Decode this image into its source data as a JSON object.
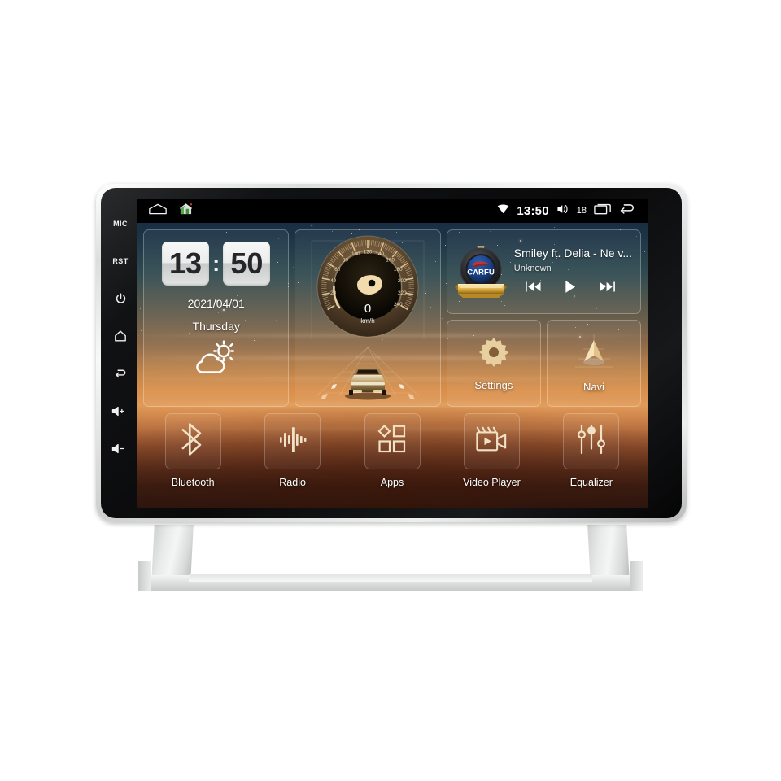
{
  "device": {
    "name": "car-head-unit",
    "bezel_color": "#0a0a0b",
    "chrome_color": "#e8eae9"
  },
  "side_keys": [
    {
      "label": "MIC",
      "icon": "mic-label",
      "name": "side-key-mic"
    },
    {
      "label": "RST",
      "icon": "reset-label",
      "name": "side-key-reset"
    },
    {
      "label": "",
      "icon": "power-icon",
      "name": "side-key-power"
    },
    {
      "label": "",
      "icon": "home-icon",
      "name": "side-key-home"
    },
    {
      "label": "",
      "icon": "back-icon",
      "name": "side-key-back"
    },
    {
      "label": "",
      "icon": "volume-up-icon",
      "name": "side-key-volume-up"
    },
    {
      "label": "",
      "icon": "volume-down-icon",
      "name": "side-key-volume-down"
    }
  ],
  "status_bar": {
    "left_icons": [
      "home-outline-icon",
      "house-color-icon"
    ],
    "wifi_icon": "wifi-icon",
    "time": "13:50",
    "volume_icon": "volume-icon",
    "volume_level": "18",
    "recents_icon": "recents-icon",
    "back_icon": "back-arrow-icon"
  },
  "clock_widget": {
    "hours": "13",
    "separator": ":",
    "minutes": "50",
    "date": "2021/04/01",
    "weekday": "Thursday",
    "weather_icon": "partly-cloudy-icon"
  },
  "speedometer": {
    "value": "0",
    "unit": "km/h",
    "ticks": [
      "0",
      "20",
      "40",
      "60",
      "80",
      "100",
      "120",
      "140",
      "160",
      "180",
      "200",
      "220",
      "240"
    ],
    "min": 0,
    "max": 240,
    "needle_icon": "speed-pointer-icon",
    "road_icon": "car-on-road-icon"
  },
  "music_widget": {
    "logo_text": "CARFU",
    "logo_icon": "carfu-badge-icon",
    "title": "Smiley ft. Delia - Ne v...",
    "artist": "Unknown",
    "controls": [
      {
        "name": "previous-button",
        "icon": "previous-track-icon"
      },
      {
        "name": "play-button",
        "icon": "play-icon"
      },
      {
        "name": "next-button",
        "icon": "next-track-icon"
      }
    ]
  },
  "tiles": [
    {
      "label": "Settings",
      "icon": "gear-icon",
      "name": "tile-settings"
    },
    {
      "label": "Navi",
      "icon": "navigation-icon",
      "name": "tile-navi"
    }
  ],
  "dock": [
    {
      "label": "Bluetooth",
      "icon": "bluetooth-icon",
      "name": "dock-bluetooth"
    },
    {
      "label": "Radio",
      "icon": "radio-waves-icon",
      "name": "dock-radio"
    },
    {
      "label": "Apps",
      "icon": "apps-grid-icon",
      "name": "dock-apps"
    },
    {
      "label": "Video Player",
      "icon": "video-camera-icon",
      "name": "dock-video-player"
    },
    {
      "label": "Equalizer",
      "icon": "equalizer-icon",
      "name": "dock-equalizer"
    }
  ]
}
